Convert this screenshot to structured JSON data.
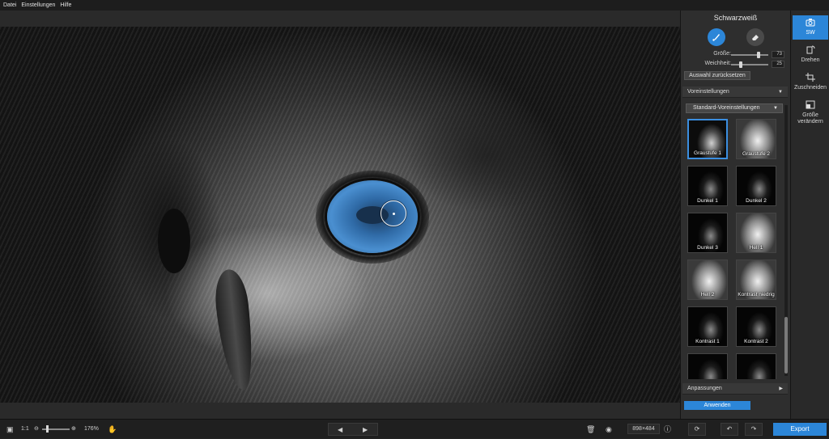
{
  "menu": {
    "items": [
      "Datei",
      "Einstellungen",
      "Hilfe"
    ]
  },
  "panel": {
    "title": "Schwarzweiß",
    "size_label": "Größe:",
    "size_value": "73",
    "size_fraction": 0.73,
    "softness_label": "Weichheit:",
    "softness_value": "25",
    "softness_fraction": 0.25,
    "reset_label": "Auswahl zurücksetzen",
    "presets_header": "Voreinstellungen",
    "preset_selected": "Standard-Voreinstellungen",
    "presets": [
      {
        "label": "Graustufe 1",
        "selected": true
      },
      {
        "label": "Graustufe 2",
        "selected": false
      },
      {
        "label": "Dunkel 1",
        "selected": false
      },
      {
        "label": "Dunkel 2",
        "selected": false
      },
      {
        "label": "Dunkel 3",
        "selected": false
      },
      {
        "label": "Hell 1",
        "selected": false
      },
      {
        "label": "Hell 2",
        "selected": false
      },
      {
        "label": "Kontrast niedrig",
        "selected": false
      },
      {
        "label": "Kontrast 1",
        "selected": false
      },
      {
        "label": "Kontrast 2",
        "selected": false
      },
      {
        "label": "",
        "selected": false
      },
      {
        "label": "",
        "selected": false
      }
    ],
    "adjust_header": "Anpassungen",
    "apply_label": "Anwenden"
  },
  "rail": {
    "items": [
      {
        "label": "SW",
        "icon": "camera-icon",
        "active": true
      },
      {
        "label": "Drehen",
        "icon": "rotate-icon",
        "active": false
      },
      {
        "label": "Zuschneiden",
        "icon": "crop-icon",
        "active": false
      },
      {
        "label": "Größe verändern",
        "icon": "resize-icon",
        "active": false
      }
    ]
  },
  "bottom": {
    "ratio_label": "1:1",
    "zoom_percent": "176%",
    "zoom_fraction": 0.15,
    "dimensions": "898×484",
    "export_label": "Export"
  }
}
